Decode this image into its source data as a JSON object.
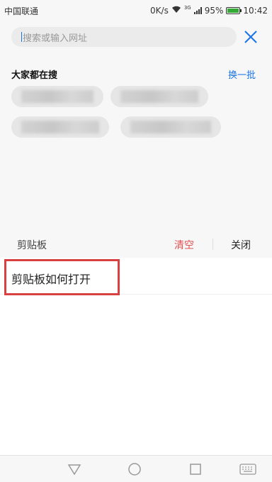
{
  "status_bar": {
    "carrier": "中国联通",
    "network_speed": "0K/s",
    "network_type": "3G",
    "battery_percent": "95%",
    "time": "10:42"
  },
  "search": {
    "placeholder": "搜索或输入网址",
    "close_icon": "close-x-icon",
    "accent_color": "#1a73e8"
  },
  "trending": {
    "title": "大家都在搜",
    "refresh_label": "换一批"
  },
  "clipboard": {
    "title": "剪贴板",
    "clear_label": "清空",
    "close_label": "关闭",
    "clear_color": "#e05050",
    "items": [
      {
        "text": "剪贴板如何打开"
      }
    ]
  },
  "nav_bar": {
    "buttons": [
      "back-triangle-icon",
      "home-circle-icon",
      "recents-square-icon",
      "keyboard-icon"
    ]
  }
}
